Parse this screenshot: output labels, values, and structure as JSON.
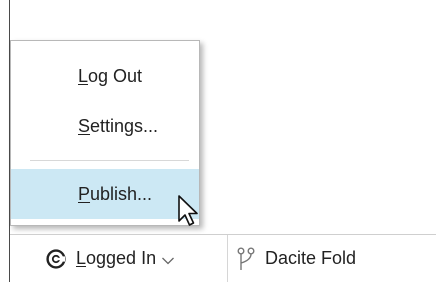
{
  "menu": {
    "items": [
      {
        "label": "Log Out",
        "mnemonic": "L",
        "rest": "og Out"
      },
      {
        "label": "Settings...",
        "mnemonic": "S",
        "rest": "ettings..."
      },
      {
        "label": "Publish...",
        "mnemonic": "P",
        "rest": "ublish..."
      }
    ],
    "highlight_color": "#cce8f4"
  },
  "status_bar": {
    "account": {
      "icon": "brand-c-icon",
      "label": "Logged In",
      "mnemonic": "L",
      "rest": "ogged In",
      "dropdown_icon": "chevron-down-icon"
    },
    "project": {
      "icon": "branch-icon",
      "label": "Dacite Fold"
    }
  },
  "cursor": {
    "icon": "arrow-cursor-icon"
  }
}
